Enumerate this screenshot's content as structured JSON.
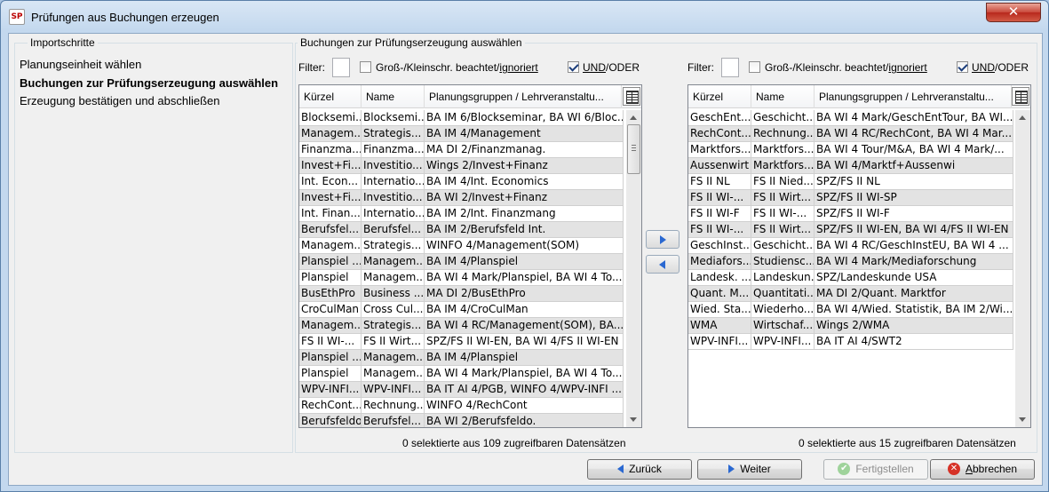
{
  "window": {
    "app_icon_text": "SP",
    "title": "Prüfungen aus Buchungen erzeugen",
    "close_glyph": "✕"
  },
  "steps": {
    "legend": "Importschritte",
    "items": [
      {
        "label": "Planungseinheit wählen",
        "active": false
      },
      {
        "label": "Buchungen zur Prüfungserzeugung auswählen",
        "active": true
      },
      {
        "label": "Erzeugung bestätigen und abschließen",
        "active": false
      }
    ]
  },
  "main": {
    "legend": "Buchungen zur Prüfungserzeugung auswählen"
  },
  "filter_left": {
    "label": "Filter:",
    "value": "",
    "case_label_part1": "Groß-/Kleinschr. beachtet/",
    "case_label_part2": "ignoriert",
    "case_checked": false,
    "logic_label_part1": "UND",
    "logic_label_part2": "/ODER",
    "logic_checked": true
  },
  "filter_right": {
    "label": "Filter:",
    "value": "",
    "case_label_part1": "Groß-/Kleinschr. beachtet/",
    "case_label_part2": "ignoriert",
    "case_checked": false,
    "logic_label_part1": "UND",
    "logic_label_part2": "/ODER",
    "logic_checked": true
  },
  "table_left": {
    "columns": [
      "Kürzel",
      "Name",
      "Planungsgruppen / Lehrveranstaltu..."
    ],
    "columns_icon": "column-chooser-icon",
    "rows": [
      [
        "Blocksemi...",
        "Blocksemi...",
        "BA IM 6/Blockseminar, BA WI 6/Bloc..."
      ],
      [
        "Managem...",
        "Strategis...",
        "BA IM 4/Management"
      ],
      [
        "Finanzma...",
        "Finanzma...",
        "MA DI 2/Finanzmanag."
      ],
      [
        "Invest+Fi...",
        "Investitio...",
        "Wings 2/Invest+Finanz"
      ],
      [
        "Int. Econ...",
        "Internatio...",
        "BA IM 4/Int. Economics"
      ],
      [
        "Invest+Fi...",
        "Investitio...",
        "BA WI 2/Invest+Finanz"
      ],
      [
        "Int. Finan...",
        "Internatio...",
        "BA IM 2/Int. Finanzmang"
      ],
      [
        "Berufsfel...",
        "Berufsfel...",
        "BA IM 2/Berufsfeld Int."
      ],
      [
        "Managem...",
        "Strategis...",
        "WINFO 4/Management(SOM)"
      ],
      [
        "Planspiel ...",
        "Managem...",
        "BA IM 4/Planspiel"
      ],
      [
        "Planspiel",
        "Managem...",
        "BA WI 4 Mark/Planspiel, BA WI 4 To..."
      ],
      [
        "BusEthPro",
        "Business ...",
        "MA DI 2/BusEthPro"
      ],
      [
        "CroCulMan",
        "Cross Cul...",
        "BA IM 4/CroCulMan"
      ],
      [
        "Managem...",
        "Strategis...",
        "BA WI 4 RC/Management(SOM), BA..."
      ],
      [
        "FS II WI-...",
        "FS II Wirt...",
        "SPZ/FS II WI-EN, BA WI 4/FS II WI-EN"
      ],
      [
        "Planspiel ...",
        "Managem...",
        "BA IM 4/Planspiel"
      ],
      [
        "Planspiel",
        "Managem...",
        "BA WI 4 Mark/Planspiel, BA WI 4 To..."
      ],
      [
        "WPV-INFI...",
        "WPV-INFI...",
        "BA IT AI 4/PGB, WINFO 4/WPV-INFI ..."
      ],
      [
        "RechCont...",
        "Rechnung...",
        "WINFO 4/RechCont"
      ],
      [
        "Berufsfeldo.",
        "Berufsfel...",
        "BA WI 2/Berufsfeldo."
      ]
    ],
    "count_text": "0 selektierte aus 109 zugreifbaren Datensätzen"
  },
  "table_right": {
    "columns": [
      "Kürzel",
      "Name",
      "Planungsgruppen / Lehrveranstaltu..."
    ],
    "columns_icon": "column-chooser-icon",
    "rows": [
      [
        "GeschEnt...",
        "Geschicht...",
        "BA WI 4 Mark/GeschEntTour, BA WI..."
      ],
      [
        "RechCont...",
        "Rechnung...",
        "BA WI 4 RC/RechCont, BA WI 4 Mar..."
      ],
      [
        "Marktfors...",
        "Marktfors...",
        "BA WI 4 Tour/M&A, BA WI 4 Mark/..."
      ],
      [
        "Aussenwirt",
        "Marktfors...",
        "BA WI 4/Marktf+Aussenwi"
      ],
      [
        "FS II NL",
        "FS II Nied...",
        "SPZ/FS II NL"
      ],
      [
        "FS II WI-...",
        "FS II Wirt...",
        "SPZ/FS II WI-SP"
      ],
      [
        "FS II WI-F",
        "FS II WI-...",
        "SPZ/FS II WI-F"
      ],
      [
        "FS II WI-...",
        "FS II Wirt...",
        "SPZ/FS II WI-EN, BA WI 4/FS II WI-EN"
      ],
      [
        "GeschInst...",
        "Geschicht...",
        "BA WI 4 RC/GeschInstEU, BA WI 4 ..."
      ],
      [
        "Mediafors...",
        "Studiensc...",
        "BA WI 4 Mark/Mediaforschung"
      ],
      [
        "Landesk. ...",
        "Landeskun...",
        "SPZ/Landeskunde USA"
      ],
      [
        "Quant. M...",
        "Quantitati...",
        "MA DI 2/Quant. Marktfor"
      ],
      [
        "Wied. Sta...",
        "Wiederho...",
        "BA WI 4/Wied. Statistik, BA IM 2/Wi..."
      ],
      [
        "WMA",
        "Wirtschaf...",
        "Wings 2/WMA"
      ],
      [
        "WPV-INFI...",
        "WPV-INFI...",
        "BA IT AI 4/SWT2"
      ]
    ],
    "count_text": "0 selektierte aus 15 zugreifbaren Datensätzen"
  },
  "buttons": {
    "back": "Zurück",
    "next": "Weiter",
    "finish": "Fertigstellen",
    "cancel_prefix": "A",
    "cancel_rest": "bbrechen",
    "check_glyph": "✔",
    "cancel_glyph": "✕"
  }
}
